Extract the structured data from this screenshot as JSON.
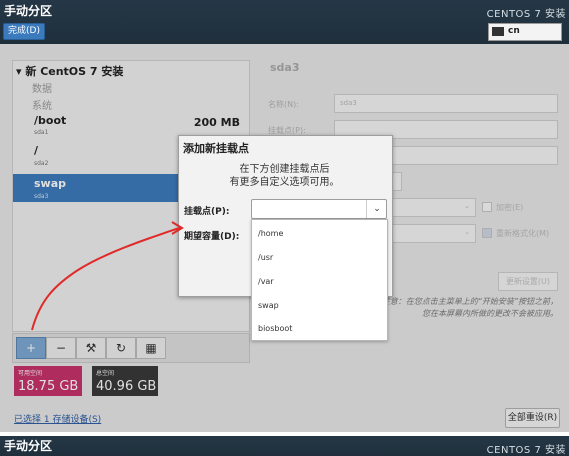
{
  "header": {
    "title": "手动分区",
    "done_label": "完成(D)",
    "product": "CENTOS 7 安装",
    "keyboard": "cn"
  },
  "left_panel": {
    "install_header": "新 CentOS 7 安装",
    "category_data": "数据",
    "category_system": "系统",
    "partitions": [
      {
        "name": "/boot",
        "device": "sda1",
        "size": "200 MB"
      },
      {
        "name": "/",
        "device": "sda2",
        "size": ""
      },
      {
        "name": "swap",
        "device": "sda3",
        "size": ""
      }
    ],
    "toolbar": {
      "add": "+",
      "remove": "−",
      "configure": "⚒",
      "refresh": "↻",
      "disk": "▦"
    },
    "available_space_label": "可用空间",
    "available_space_value": "18.75 GB",
    "total_space_label": "总空间",
    "total_space_value": "40.96 GB",
    "storage_link": "已选择 1 存储设备(S)"
  },
  "right_panel": {
    "title": "sda3",
    "name_label": "名称(N):",
    "name_value": "sda3",
    "mount_label": "挂载点(P):",
    "encrypt_label": "加密(E)",
    "reformat_label": "重新格式化(M)",
    "update_button": "更新设置(U)",
    "help_line1": "注意：在您点击主菜单上的“开始安装”按钮之前，",
    "help_line2": "您在本屏幕内所做的更改不会被应用。",
    "reset_all": "全部重设(R)"
  },
  "dialog": {
    "title": "添加新挂载点",
    "desc_line1": "在下方创建挂载点后",
    "desc_line2": "有更多自定义选项可用。",
    "mount_label": "挂载点(P):",
    "capacity_label": "期望容量(D):",
    "mount_value": "",
    "options": [
      "/home",
      "/usr",
      "/var",
      "swap",
      "biosboot"
    ]
  },
  "colors": {
    "header_bg": "#253746",
    "selection": "#3e7bbd",
    "free_space": "#c8336b",
    "annotation_arrow": "#e02a2a"
  }
}
